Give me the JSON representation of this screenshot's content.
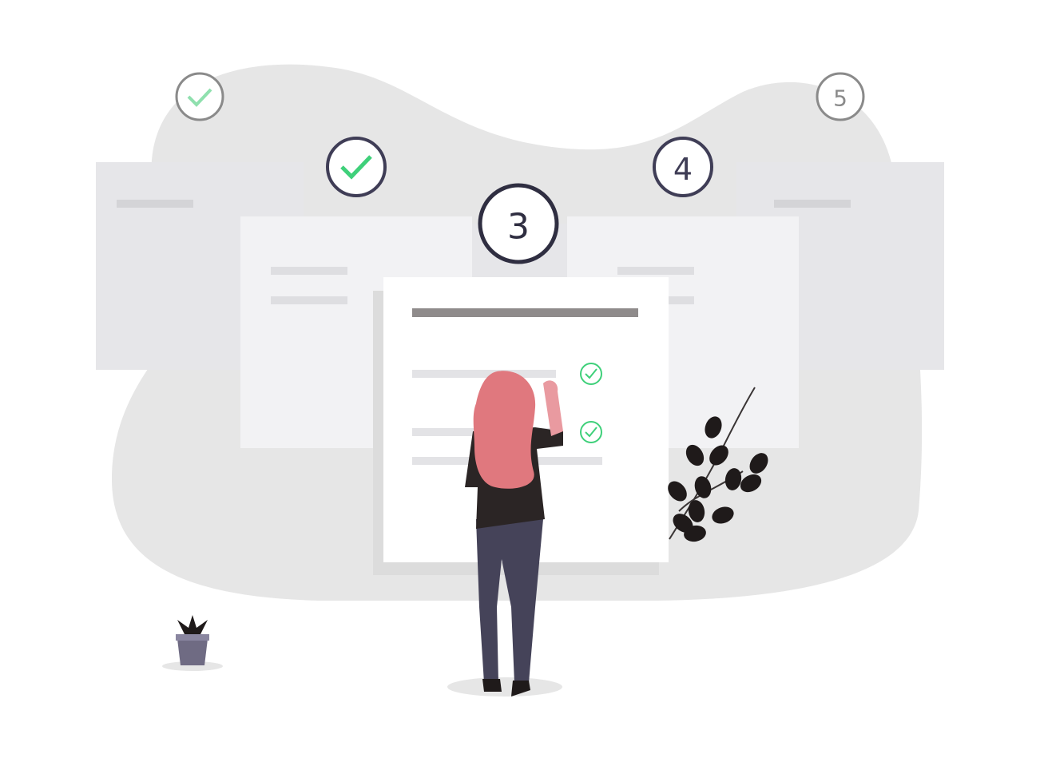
{
  "steps": [
    {
      "label": "",
      "state": "complete"
    },
    {
      "label": "",
      "state": "complete"
    },
    {
      "label": "3",
      "state": "current"
    },
    {
      "label": "4",
      "state": "upcoming"
    },
    {
      "label": "5",
      "state": "upcoming"
    }
  ],
  "colors": {
    "blob": "#e6e6e6",
    "card_far": "#e6e6e9",
    "card_mid": "#f2f2f4",
    "card_front": "#ffffff",
    "card_shadow": "#dcdcdc",
    "line_light": "#dedee1",
    "title_bar": "#8f8b8b",
    "check_green": "#3fd07a",
    "ring_dark": "#2f2e41",
    "ring_light": "#8a8a8a",
    "hair": "#e0787e",
    "shirt": "#2b2525",
    "jeans": "#454359",
    "skin": "#e99aa0",
    "plant": "#1f1a1a",
    "pot": "#6f6b83"
  },
  "icons": [
    "check-icon",
    "plant-icon",
    "pot-icon",
    "person-figure"
  ]
}
